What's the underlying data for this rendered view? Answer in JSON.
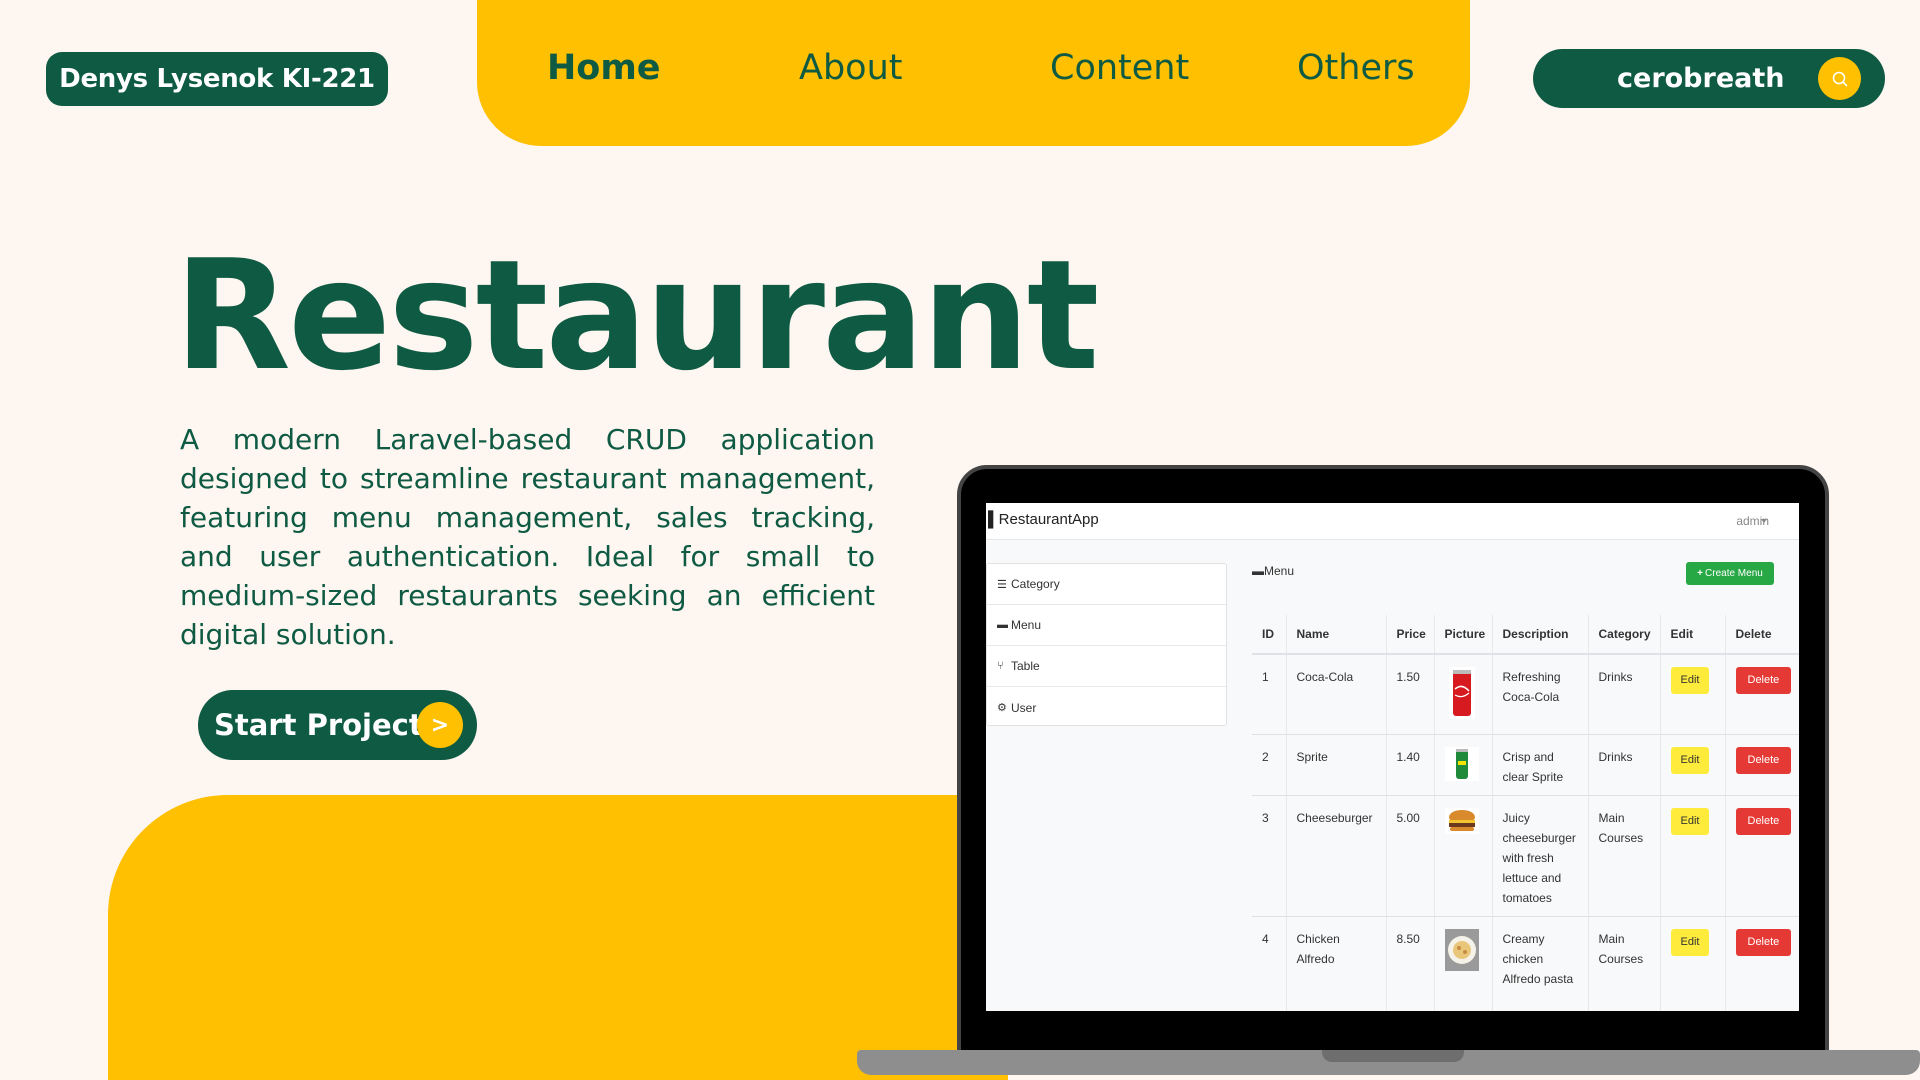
{
  "header": {
    "author": "Denys Lysenok KI-221",
    "nav": [
      "Home",
      "About",
      "Content",
      "Others"
    ],
    "active_nav": "Home",
    "search_label": "cerobreath",
    "search_icon": "search-icon"
  },
  "hero": {
    "title": "Restaurant",
    "description": "A modern Laravel-based CRUD application designed to streamline restaurant management, featuring menu management, sales tracking, and user authentication. Ideal for small to medium-sized restaurants seeking an efficient digital solution.",
    "cta": "Start Project",
    "cta_arrow": ">"
  },
  "colors": {
    "primary": "#0f5a43",
    "accent": "#fec000",
    "background": "#fdf6f1",
    "create_button": "#28a745",
    "edit_button": "#ffeb3b",
    "delete_button": "#e53935"
  },
  "app": {
    "brand": "RestaurantApp",
    "user": "admin",
    "sidebar": [
      "Category",
      "Menu",
      "Table",
      "User"
    ],
    "section_title": "Menu",
    "create_button": "Create Menu",
    "columns": [
      "ID",
      "Name",
      "Price",
      "Picture",
      "Description",
      "Category",
      "Edit",
      "Delete"
    ],
    "edit_label": "Edit",
    "delete_label": "Delete",
    "rows": [
      {
        "id": "1",
        "name": "Coca-Cola",
        "price": "1.50",
        "picture": "coca-cola-can",
        "description": "Refreshing Coca-Cola",
        "category": "Drinks"
      },
      {
        "id": "2",
        "name": "Sprite",
        "price": "1.40",
        "picture": "sprite-can",
        "description": "Crisp and clear Sprite",
        "category": "Drinks"
      },
      {
        "id": "3",
        "name": "Cheeseburger",
        "price": "5.00",
        "picture": "cheeseburger",
        "description": "Juicy cheeseburger with fresh lettuce and tomatoes",
        "category": "Main Courses"
      },
      {
        "id": "4",
        "name": "Chicken Alfredo",
        "price": "8.50",
        "picture": "chicken-alfredo",
        "description": "Creamy chicken Alfredo pasta",
        "category": "Main Courses"
      }
    ]
  }
}
